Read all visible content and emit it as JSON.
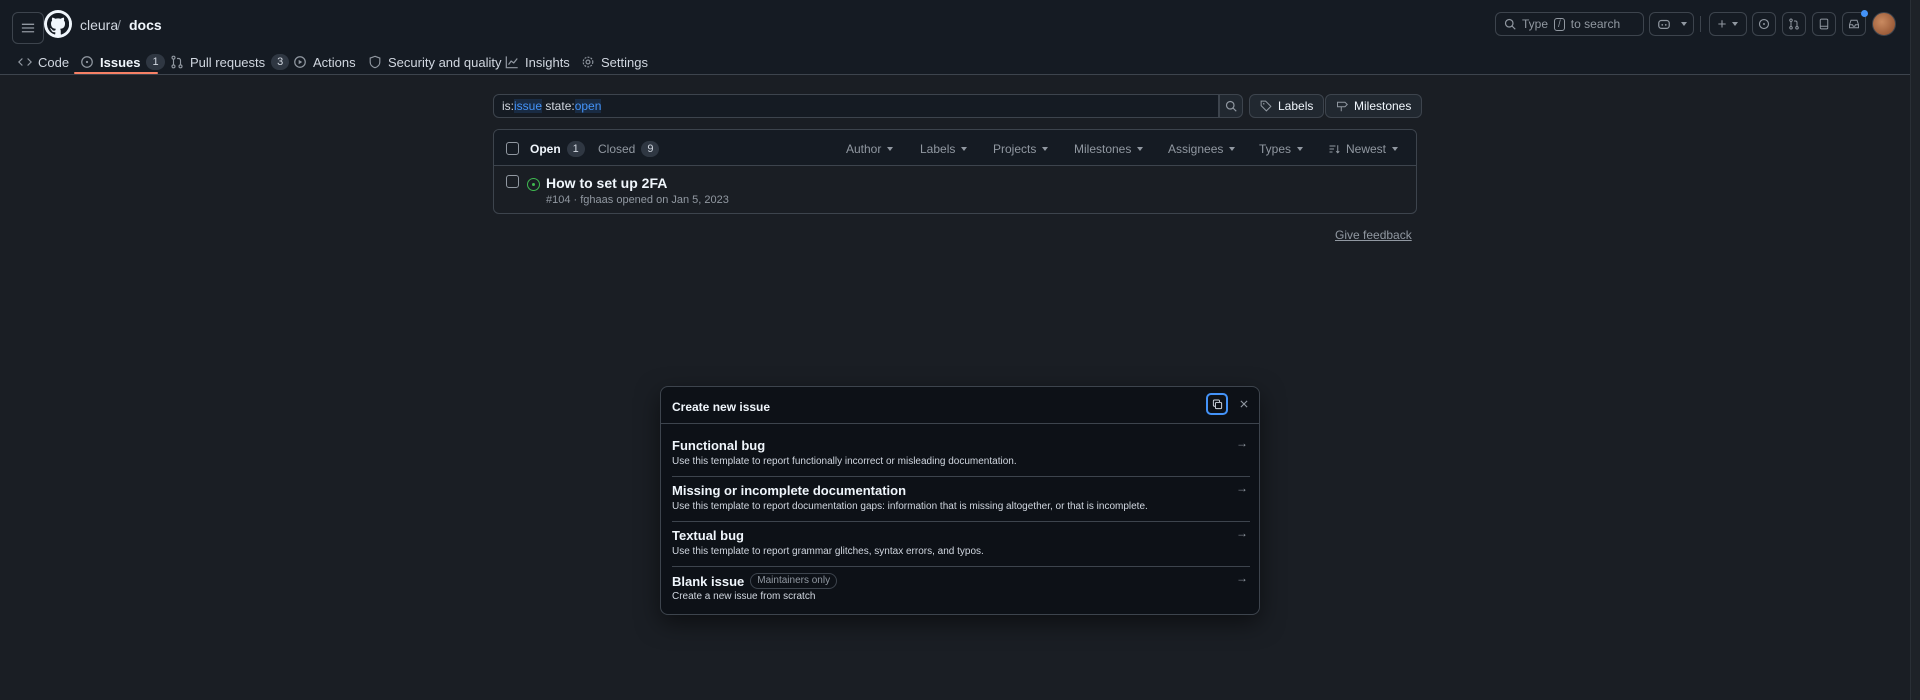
{
  "header": {
    "owner": "cleura",
    "separator": "/",
    "repo": "docs",
    "search_prefix": "Type",
    "search_key": "/",
    "search_suffix": "to search"
  },
  "tabs": [
    {
      "label": "Code",
      "icon": "code-icon"
    },
    {
      "label": "Issues",
      "icon": "issue-opened-icon",
      "count": "1"
    },
    {
      "label": "Pull requests",
      "icon": "git-pull-request-icon",
      "count": "3"
    },
    {
      "label": "Actions",
      "icon": "play-icon"
    },
    {
      "label": "Security and quality",
      "icon": "shield-icon"
    },
    {
      "label": "Insights",
      "icon": "graph-icon"
    },
    {
      "label": "Settings",
      "icon": "gear-icon"
    }
  ],
  "filter": {
    "is_key": "is:",
    "is_val": "issue",
    "state_key": " state:",
    "state_val": "open",
    "labels_button": "Labels",
    "milestones_button": "Milestones"
  },
  "list": {
    "open_label": "Open",
    "open_count": "1",
    "closed_label": "Closed",
    "closed_count": "9",
    "filters": [
      "Author",
      "Labels",
      "Projects",
      "Milestones",
      "Assignees",
      "Types",
      "Newest"
    ],
    "issues": [
      {
        "title": "How to set up 2FA",
        "meta": "#104 · fghaas opened on Jan 5, 2023"
      }
    ]
  },
  "feedback": "Give feedback",
  "dialog": {
    "title": "Create new issue",
    "templates": [
      {
        "name": "Functional bug",
        "desc": "Use this template to report functionally incorrect or misleading documentation."
      },
      {
        "name": "Missing or incomplete documentation",
        "desc": "Use this template to report documentation gaps: information that is missing altogether, or that is incomplete."
      },
      {
        "name": "Textual bug",
        "desc": "Use this template to report grammar glitches, syntax errors, and typos."
      },
      {
        "name": "Blank issue",
        "badge": "Maintainers only",
        "desc": "Create a new issue from scratch"
      }
    ]
  },
  "colors": {
    "accent": "#4493f8",
    "tab_underline": "#f78166",
    "open_green": "#3fb950",
    "background": "#1a1e24"
  }
}
